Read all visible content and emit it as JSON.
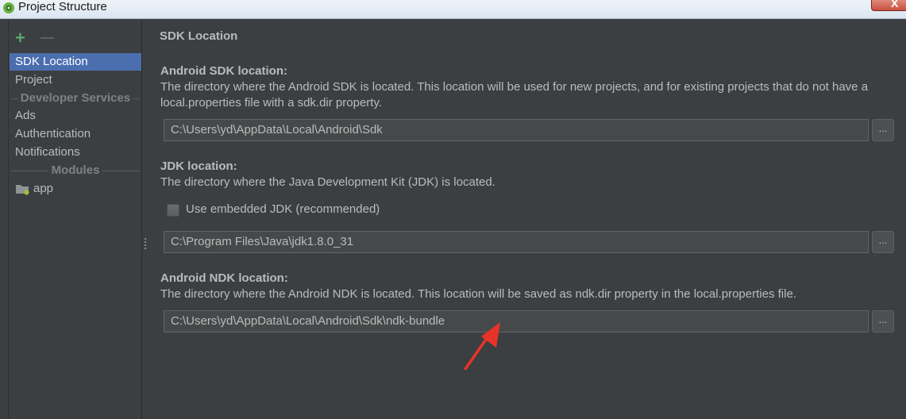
{
  "window": {
    "title": "Project Structure",
    "close_glyph": "X"
  },
  "toolbar": {
    "add_glyph": "+",
    "remove_glyph": "—"
  },
  "sidebar": {
    "items": [
      {
        "label": "SDK Location",
        "selected": true
      },
      {
        "label": "Project"
      },
      {
        "label": "Ads"
      },
      {
        "label": "Authentication"
      },
      {
        "label": "Notifications"
      }
    ],
    "headers": {
      "developer_services": "Developer Services",
      "modules": "Modules"
    },
    "modules": [
      {
        "label": "app",
        "icon": "module-folder-icon"
      }
    ]
  },
  "main": {
    "section_title": "SDK Location",
    "android_sdk": {
      "heading": "Android SDK location:",
      "description": "The directory where the Android SDK is located. This location will be used for new projects, and for existing projects that do not have a local.properties file with a sdk.dir property.",
      "path": "C:\\Users\\yd\\AppData\\Local\\Android\\Sdk"
    },
    "jdk": {
      "heading": "JDK location:",
      "description": "The directory where the Java Development Kit (JDK) is located.",
      "embedded_label": "Use embedded JDK (recommended)",
      "embedded_checked": false,
      "path": "C:\\Program Files\\Java\\jdk1.8.0_31"
    },
    "android_ndk": {
      "heading": "Android NDK location:",
      "description": "The directory where the Android NDK is located. This location will be saved as ndk.dir property in the local.properties file.",
      "path": "C:\\Users\\yd\\AppData\\Local\\Android\\Sdk\\ndk-bundle"
    },
    "browse_label": "..."
  },
  "colors": {
    "background": "#3c3f41",
    "selection": "#4b6eaf",
    "add": "#59a869",
    "annotation_arrow": "#e8332a"
  }
}
